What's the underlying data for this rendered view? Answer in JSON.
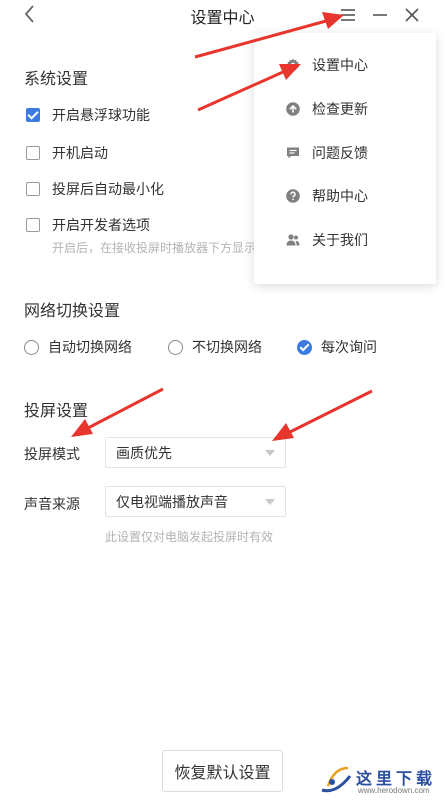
{
  "window": {
    "title": "设置中心",
    "back_icon": "chevron-left-icon",
    "controls": [
      "menu-icon",
      "minimize-icon",
      "close-icon"
    ]
  },
  "system": {
    "title": "系统设置",
    "options": [
      {
        "label": "开启悬浮球功能",
        "checked": true
      },
      {
        "label": "开机启动",
        "checked": false
      },
      {
        "label": "投屏后自动最小化",
        "checked": false
      },
      {
        "label": "开启开发者选项",
        "checked": false
      }
    ],
    "dev_hint": "开启后，在接收投屏时播放器下方显示"
  },
  "network": {
    "title": "网络切换设置",
    "options": [
      {
        "label": "自动切换网络",
        "selected": false
      },
      {
        "label": "不切换网络",
        "selected": false
      },
      {
        "label": "每次询问",
        "selected": true
      }
    ]
  },
  "cast": {
    "title": "投屏设置",
    "mode_label": "投屏模式",
    "mode_value": "画质优先",
    "audio_label": "声音来源",
    "audio_value": "仅电视端播放声音",
    "audio_hint": "此设置仅对电脑发起投屏时有效"
  },
  "reset_button": "恢复默认设置",
  "menu": {
    "items": [
      {
        "label": "设置中心",
        "icon": "gear-icon"
      },
      {
        "label": "检查更新",
        "icon": "upload-arrow-icon"
      },
      {
        "label": "问题反馈",
        "icon": "feedback-icon"
      },
      {
        "label": "帮助中心",
        "icon": "question-icon"
      },
      {
        "label": "关于我们",
        "icon": "people-icon"
      }
    ]
  },
  "watermark": {
    "text": "这里下载",
    "url": "www.herodown.com"
  },
  "colors": {
    "accent": "#3b7be0",
    "annotation_arrow": "#e8352d"
  }
}
